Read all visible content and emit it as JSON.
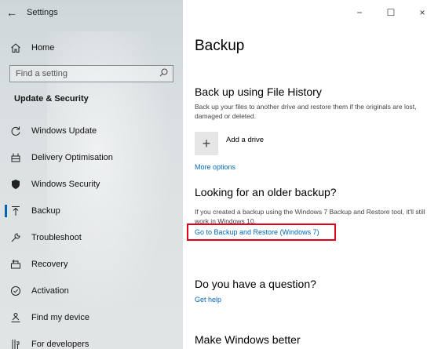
{
  "window": {
    "back_glyph": "←",
    "app_title": "Settings",
    "minimize_glyph": "−",
    "maximize_glyph": "☐",
    "close_glyph": "×"
  },
  "sidebar": {
    "home_label": "Home",
    "search_placeholder": "Find a setting",
    "section_title": "Update & Security",
    "items": [
      {
        "label": "Windows Update",
        "icon": "refresh-icon"
      },
      {
        "label": "Delivery Optimisation",
        "icon": "delivery-optimisation-icon"
      },
      {
        "label": "Windows Security",
        "icon": "shield-icon"
      },
      {
        "label": "Backup",
        "icon": "backup-icon"
      },
      {
        "label": "Troubleshoot",
        "icon": "wrench-icon"
      },
      {
        "label": "Recovery",
        "icon": "recovery-icon"
      },
      {
        "label": "Activation",
        "icon": "activation-icon"
      },
      {
        "label": "Find my device",
        "icon": "person-pin-icon"
      },
      {
        "label": "For developers",
        "icon": "developer-icon"
      }
    ],
    "selected_index": 3
  },
  "main": {
    "title": "Backup",
    "file_history": {
      "heading": "Back up using File History",
      "description": "Back up your files to another drive and restore them if the originals are lost, damaged or deleted.",
      "add_drive_label": "Add a drive",
      "more_options": "More options"
    },
    "older_backup": {
      "heading": "Looking for an older backup?",
      "description": "If you created a backup using the Windows 7 Backup and Restore tool, it'll still work in Windows 10.",
      "link": "Go to Backup and Restore (Windows 7)"
    },
    "question": {
      "heading": "Do you have a question?",
      "link": "Get help"
    },
    "better": {
      "heading": "Make Windows better"
    }
  },
  "colors": {
    "accent": "#0063b1",
    "link": "#0067b8",
    "highlight": "#e3001b"
  }
}
